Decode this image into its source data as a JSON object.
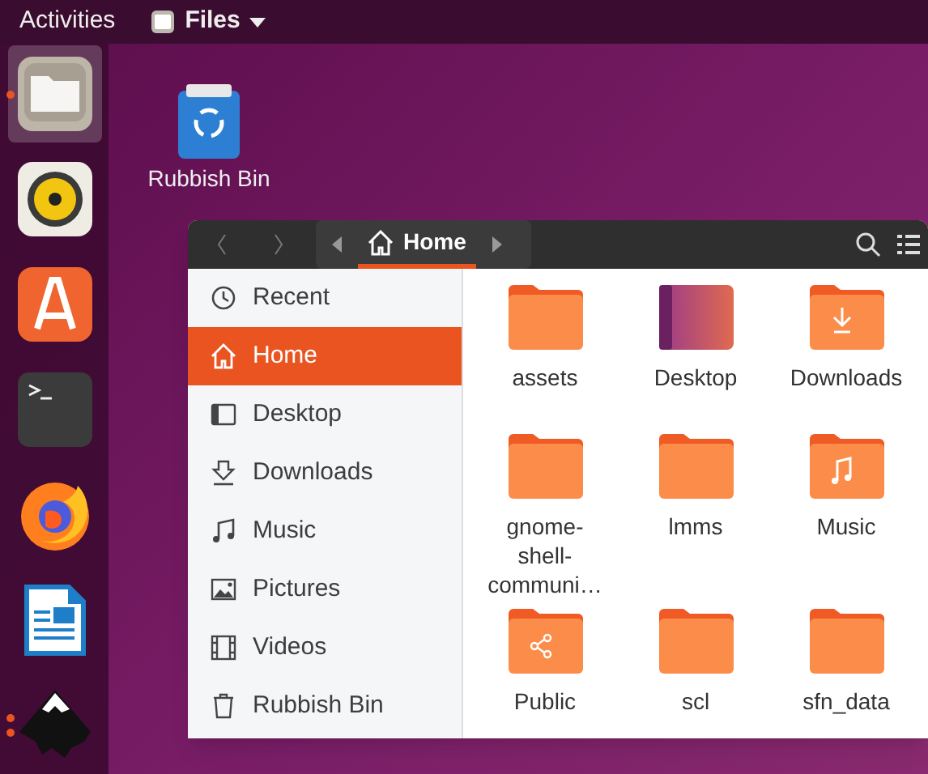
{
  "top_bar": {
    "activities": "Activities",
    "app_menu": "Files"
  },
  "dock": [
    {
      "kind": "files",
      "selected": true,
      "running": true,
      "multiple_windows": false
    },
    {
      "kind": "speaker",
      "selected": false,
      "running": false
    },
    {
      "kind": "software",
      "selected": false,
      "running": false
    },
    {
      "kind": "terminal",
      "selected": false,
      "running": false
    },
    {
      "kind": "browser",
      "selected": false,
      "running": false
    },
    {
      "kind": "writer",
      "selected": false,
      "running": false
    },
    {
      "kind": "vector",
      "selected": false,
      "running": true,
      "multiple_windows": true
    }
  ],
  "desktop_icons": [
    {
      "label": "Rubbish Bin"
    }
  ],
  "window": {
    "path": [
      {
        "label": "Home",
        "selected": true
      }
    ],
    "sidebar": {
      "items": [
        {
          "label": "Recent",
          "kind": "recent",
          "selected": false
        },
        {
          "label": "Home",
          "kind": "home",
          "selected": true
        },
        {
          "label": "Desktop",
          "kind": "desktop",
          "selected": false
        },
        {
          "label": "Downloads",
          "kind": "downloads",
          "selected": false
        },
        {
          "label": "Music",
          "kind": "music",
          "selected": false
        },
        {
          "label": "Pictures",
          "kind": "pictures",
          "selected": false
        },
        {
          "label": "Videos",
          "kind": "videos",
          "selected": false
        },
        {
          "label": "Rubbish Bin",
          "kind": "trash",
          "selected": false
        }
      ]
    },
    "files": [
      {
        "name": "assets",
        "kind": "folder"
      },
      {
        "name": "Desktop",
        "kind": "desktop"
      },
      {
        "name": "Downloads",
        "kind": "downloads"
      },
      {
        "name": "gnome-shell-communi…",
        "kind": "folder"
      },
      {
        "name": "lmms",
        "kind": "folder"
      },
      {
        "name": "Music",
        "kind": "music"
      },
      {
        "name": "Public",
        "kind": "public"
      },
      {
        "name": "scl",
        "kind": "folder"
      },
      {
        "name": "sfn_data",
        "kind": "folder"
      }
    ]
  }
}
